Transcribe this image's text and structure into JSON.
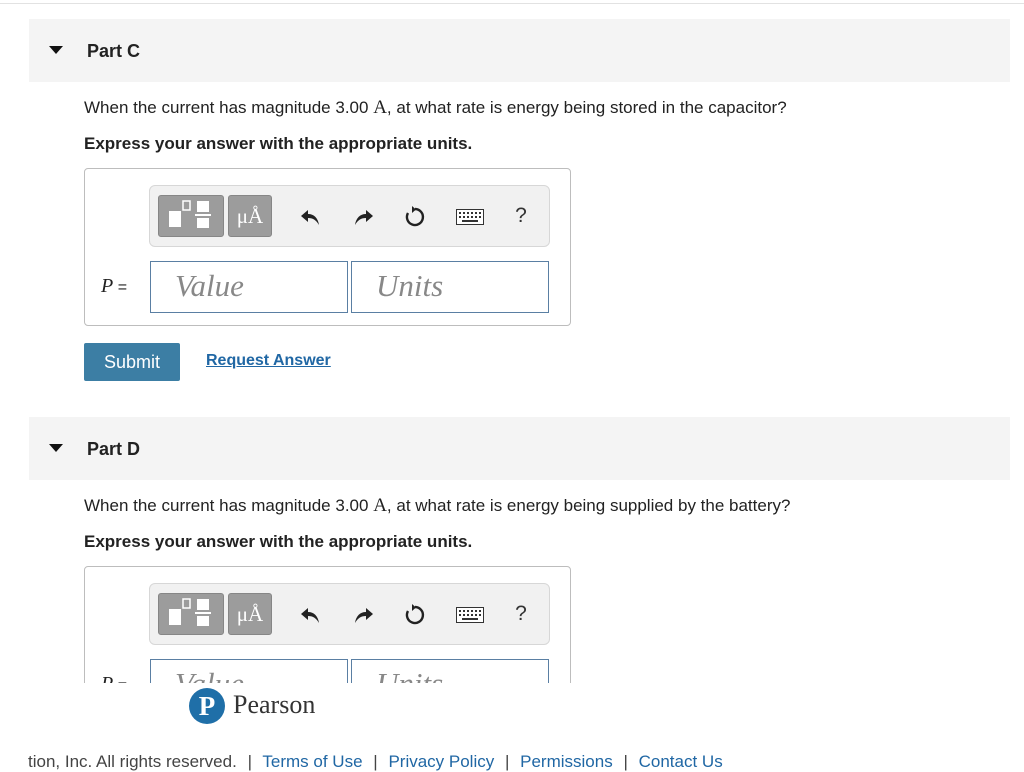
{
  "part_c": {
    "title": "Part C",
    "question_before": "When the current has magnitude 3.00 ",
    "question_unit": "A",
    "question_after": ", at what rate is energy being stored in the capacitor?",
    "instruction": "Express your answer with the appropriate units.",
    "variable": "P",
    "equals": "=",
    "value_placeholder": "Value",
    "units_placeholder": "Units",
    "units_button": "μÅ",
    "help": "?",
    "submit": "Submit",
    "request_answer": "Request Answer"
  },
  "part_d": {
    "title": "Part D",
    "question_before": "When the current has magnitude 3.00 ",
    "question_unit": "A",
    "question_after": ", at what rate is energy being supplied by the battery?",
    "instruction": "Express your answer with the appropriate units.",
    "variable": "P",
    "equals": "=",
    "value_placeholder": "Value",
    "units_placeholder": "Units",
    "units_button": "μÅ",
    "help": "?"
  },
  "brand": {
    "logo_letter": "P",
    "name": "Pearson",
    "color": "#1f6fa8"
  },
  "footer": {
    "copyright_fragment": "tion, Inc. All rights reserved.",
    "links": [
      "Terms of Use",
      "Privacy Policy",
      "Permissions",
      "Contact Us"
    ]
  },
  "icons": [
    "templates-icon",
    "undo-icon",
    "redo-icon",
    "reset-icon",
    "keyboard-icon",
    "help-icon"
  ],
  "colors": {
    "submit": "#3c7ea4",
    "link": "#2067a4",
    "header_bg": "#f4f4f4"
  }
}
